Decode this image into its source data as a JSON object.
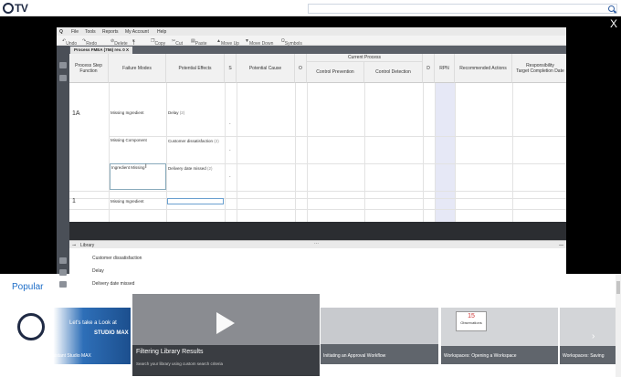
{
  "site": {
    "logo_text": "TV",
    "search_placeholder": ""
  },
  "overlay": {
    "close_label": "X"
  },
  "app": {
    "menu": [
      "File",
      "Tools",
      "Reports",
      "My Account",
      "Help"
    ],
    "toolbar": [
      "Undo",
      "Redo",
      "Delete",
      "T",
      "Copy",
      "Cut",
      "Paste",
      "Move Up",
      "Move Down",
      "Symbols"
    ],
    "tab": "Process FMEA (756) rev. 0",
    "tab_close": "X",
    "columns": {
      "step": "Process Step\nFunction",
      "failure": "Failure Modes",
      "effects": "Potential Effects",
      "s": "S",
      "cause": "Potential Cause",
      "o": "O",
      "current_process": "Current Process",
      "prevention": "Control Prevention",
      "detection": "Control Detection",
      "d": "D",
      "rpn": "RPN",
      "actions": "Recommended Actions",
      "responsibility": "Responsibility\nTarget Completion Date"
    },
    "rows": [
      {
        "id": "1A",
        "failure": "Missing Ingredient",
        "effect": "Delay",
        "effect_sev": "(2)",
        "s": "-"
      },
      {
        "id": "",
        "failure": "Missing Component",
        "effect": "Customer dissatisfaction",
        "effect_sev": "(2)",
        "s": "-"
      },
      {
        "id": "",
        "failure": "Ingredient Missing",
        "effect": "Delivery date missed",
        "effect_sev": "(2)",
        "s": "-"
      },
      {
        "id": "1",
        "failure": "Missing Ingredient",
        "effect": "",
        "effect_sev": "",
        "s": ""
      }
    ],
    "library": {
      "title": "Library",
      "items": [
        "Customer dissatisfaction",
        "Delay",
        "Delivery date missed"
      ]
    }
  },
  "popular": {
    "title": "Popular",
    "videos": [
      {
        "label": "Welcome to QA Assistant Studio MAX",
        "overlay_text": "Let's take a Look at",
        "brand": "STUDIO MAX"
      },
      {
        "label": "Filtering Library Results",
        "subtitle": "Search your library using custom search criteria"
      },
      {
        "label": "Initiating an Approval Workflow"
      },
      {
        "label": "Workspaces: Opening a Workspace",
        "badge_number": "15",
        "badge_text": "Observations"
      },
      {
        "label": "Workspaces: Saving"
      }
    ]
  },
  "colors": {
    "accent": "#1e6ec8",
    "overlay": "#000000",
    "rpn_column": "#e6e8f6"
  }
}
